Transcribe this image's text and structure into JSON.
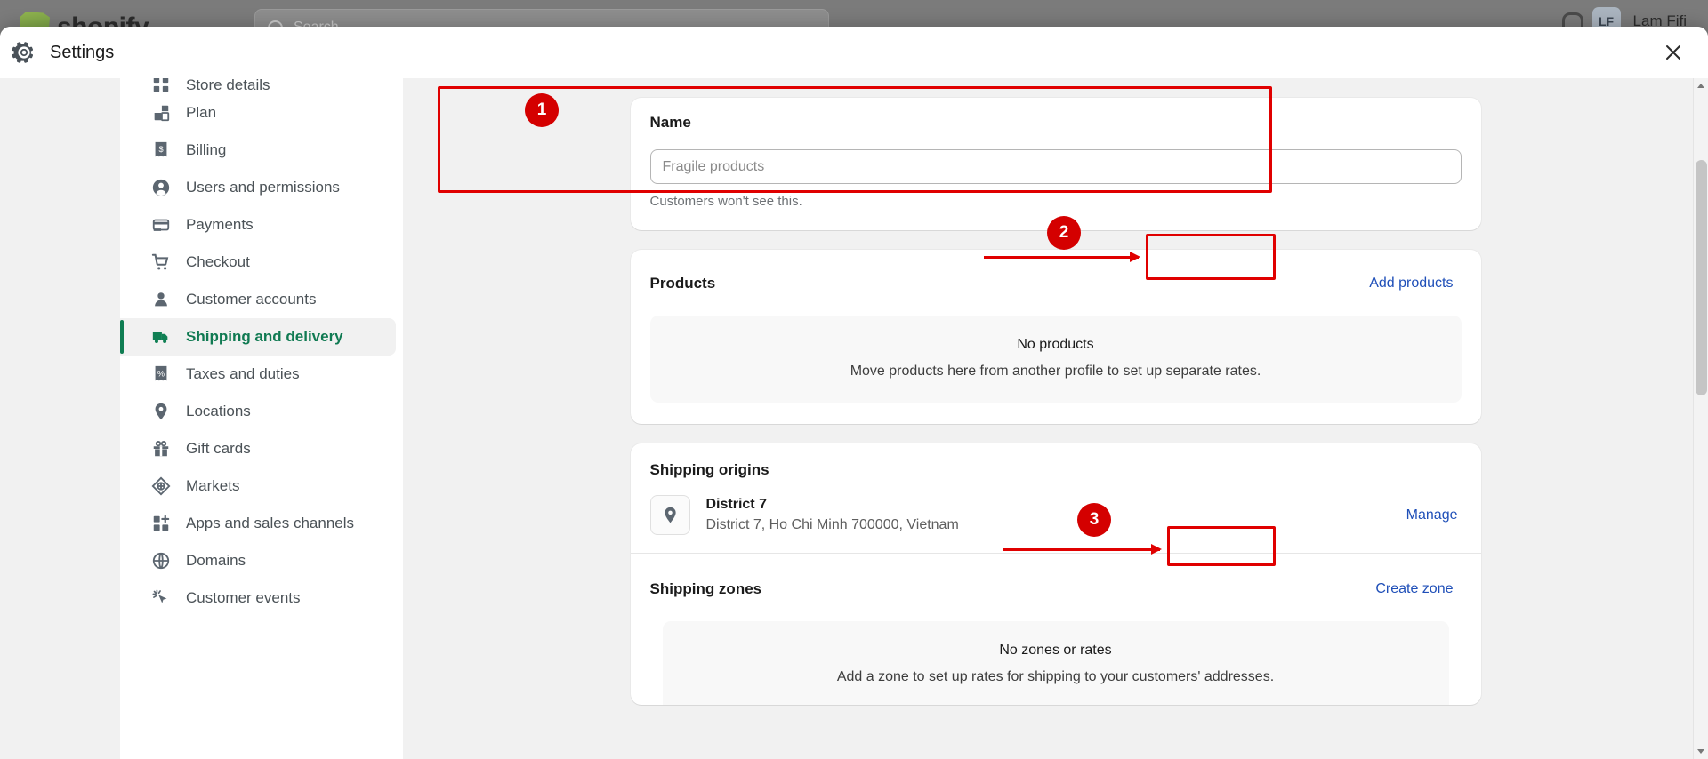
{
  "background": {
    "brand": "shopify",
    "search_placeholder": "Search",
    "user_initials": "LF",
    "user_name": "Lam Fifi"
  },
  "modal": {
    "title": "Settings",
    "gear_icon": "gear-icon",
    "close_icon": "close-icon"
  },
  "sidebar": {
    "items": [
      {
        "label": "Store details",
        "icon": "store-icon",
        "active": false,
        "partial": true
      },
      {
        "label": "Plan",
        "icon": "plan-icon",
        "active": false
      },
      {
        "label": "Billing",
        "icon": "billing-receipt-icon",
        "active": false
      },
      {
        "label": "Users and permissions",
        "icon": "user-circle-icon",
        "active": false
      },
      {
        "label": "Payments",
        "icon": "payments-card-icon",
        "active": false
      },
      {
        "label": "Checkout",
        "icon": "shopping-cart-icon",
        "active": false
      },
      {
        "label": "Customer accounts",
        "icon": "person-icon",
        "active": false
      },
      {
        "label": "Shipping and delivery",
        "icon": "delivery-truck-icon",
        "active": true
      },
      {
        "label": "Taxes and duties",
        "icon": "percent-receipt-icon",
        "active": false
      },
      {
        "label": "Locations",
        "icon": "map-pin-icon",
        "active": false
      },
      {
        "label": "Gift cards",
        "icon": "gift-icon",
        "active": false
      },
      {
        "label": "Markets",
        "icon": "globe-diamond-icon",
        "active": false
      },
      {
        "label": "Apps and sales channels",
        "icon": "apps-plus-icon",
        "active": false
      },
      {
        "label": "Domains",
        "icon": "globe-icon",
        "active": false
      },
      {
        "label": "Customer events",
        "icon": "cursor-click-icon",
        "active": false
      }
    ]
  },
  "main": {
    "name_section": {
      "title": "Name",
      "input_placeholder": "Fragile products",
      "input_value": "",
      "helper": "Customers won't see this."
    },
    "products_section": {
      "title": "Products",
      "add_button": "Add products",
      "empty_title": "No products",
      "empty_sub": "Move products here from another profile to set up separate rates."
    },
    "origins_section": {
      "title": "Shipping origins",
      "location_name": "District 7",
      "location_address": "District 7, Ho Chi Minh 700000, Vietnam",
      "manage_label": "Manage",
      "pin_icon": "map-pin-icon"
    },
    "zones_section": {
      "title": "Shipping zones",
      "create_button": "Create zone",
      "empty_title": "No zones or rates",
      "empty_sub": "Add a zone to set up rates for shipping to your customers' addresses."
    }
  },
  "annotations": {
    "step1": "1",
    "step2": "2",
    "step3": "3"
  },
  "colors": {
    "accent_green": "#0f7d52",
    "link_blue": "#1f4fb8",
    "annotation_red": "#d40000"
  }
}
